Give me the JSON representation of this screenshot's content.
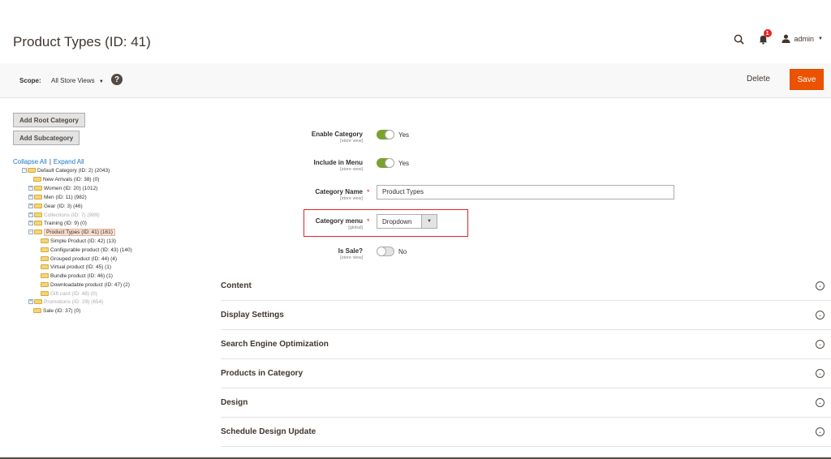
{
  "page": {
    "title": "Product Types (ID: 41)"
  },
  "header": {
    "notifications_count": "1",
    "user_name": "admin",
    "icons": {
      "search": "search-icon",
      "bell": "bell-icon",
      "user": "user-icon",
      "caret": "caret-down-icon"
    }
  },
  "scope_bar": {
    "label": "Scope:",
    "value": "All Store Views",
    "help": "?",
    "delete_label": "Delete",
    "save_label": "Save",
    "colors": {
      "save_bg": "#eb5202"
    }
  },
  "left_panel": {
    "add_root_label": "Add Root Category",
    "add_sub_label": "Add Subcategory",
    "collapse_all": "Collapse All",
    "separator": "|",
    "expand_all": "Expand All"
  },
  "tree": [
    {
      "label": "Default Category (ID: 2) (2043)",
      "toggle": "−",
      "dim": false,
      "selected": false
    },
    {
      "label": "New Arrivals (ID: 38) (0)",
      "toggle": "",
      "dim": false,
      "selected": false
    },
    {
      "label": "Women (ID: 20) (1012)",
      "toggle": "+",
      "dim": false,
      "selected": false
    },
    {
      "label": "Men (ID: 11) (982)",
      "toggle": "+",
      "dim": false,
      "selected": false
    },
    {
      "label": "Gear (ID: 3) (46)",
      "toggle": "+",
      "dim": false,
      "selected": false
    },
    {
      "label": "Collections (ID: 7) (989)",
      "toggle": "+",
      "dim": true,
      "selected": false
    },
    {
      "label": "Training (ID: 9) (0)",
      "toggle": "+",
      "dim": false,
      "selected": false
    },
    {
      "label": "Product Types (ID: 41) (161)",
      "toggle": "−",
      "dim": false,
      "selected": true
    },
    {
      "label": "Simple Product (ID: 42) (13)",
      "toggle": "",
      "dim": false,
      "selected": false
    },
    {
      "label": "Configurable product (ID: 43) (140)",
      "toggle": "",
      "dim": false,
      "selected": false
    },
    {
      "label": "Grouped product (ID: 44) (4)",
      "toggle": "",
      "dim": false,
      "selected": false
    },
    {
      "label": "Virtual product (ID: 45) (1)",
      "toggle": "",
      "dim": false,
      "selected": false
    },
    {
      "label": "Bundle product (ID: 46) (1)",
      "toggle": "",
      "dim": false,
      "selected": false
    },
    {
      "label": "Downloadable product (ID: 47) (2)",
      "toggle": "",
      "dim": false,
      "selected": false
    },
    {
      "label": "Gift card (ID: 48) (0)",
      "toggle": "",
      "dim": true,
      "selected": false
    },
    {
      "label": "Promotions (ID: 29) (654)",
      "toggle": "+",
      "dim": true,
      "selected": false
    },
    {
      "label": "Sale (ID: 37) (0)",
      "toggle": "",
      "dim": false,
      "selected": false
    }
  ],
  "form": {
    "enable_category": {
      "label": "Enable Category",
      "scope": "[store view]",
      "value": "Yes"
    },
    "include_in_menu": {
      "label": "Include in Menu",
      "scope": "[store view]",
      "value": "Yes"
    },
    "category_name": {
      "label": "Category Name",
      "scope": "[store view]",
      "required": "*",
      "value": "Product Types"
    },
    "category_menu": {
      "label": "Category menu",
      "scope": "[global]",
      "required": "*",
      "value": "Dropdown",
      "arrow": "▼"
    },
    "is_sale": {
      "label": "Is Sale?",
      "scope": "[store view]",
      "value": "No"
    }
  },
  "sections": [
    {
      "title": "Content",
      "chev": "⌄"
    },
    {
      "title": "Display Settings",
      "chev": "⌄"
    },
    {
      "title": "Search Engine Optimization",
      "chev": "⌄"
    },
    {
      "title": "Products in Category",
      "chev": "⌄"
    },
    {
      "title": "Design",
      "chev": "⌄"
    },
    {
      "title": "Schedule Design Update",
      "chev": "⌄"
    }
  ]
}
